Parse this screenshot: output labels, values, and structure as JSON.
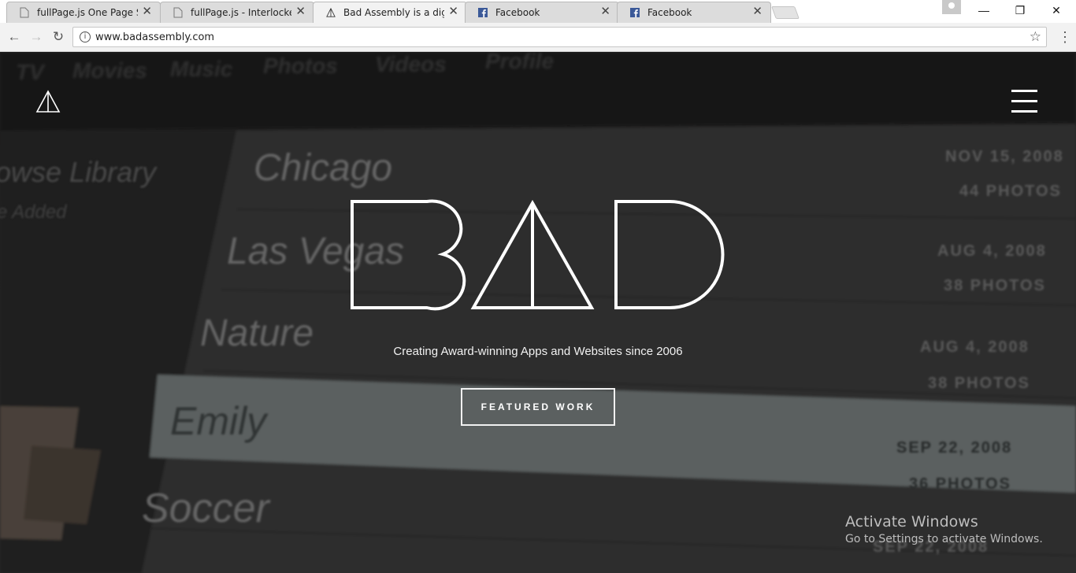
{
  "browser": {
    "tabs": [
      {
        "title": "fullPage.js One Page Scroll",
        "icon": "page-icon",
        "active": false
      },
      {
        "title": "fullPage.js - Interlocked S",
        "icon": "page-icon",
        "active": false
      },
      {
        "title": "Bad Assembly is a digital",
        "icon": "bad-triangle-icon",
        "active": true
      },
      {
        "title": "Facebook",
        "icon": "facebook-icon",
        "active": false
      },
      {
        "title": "Facebook",
        "icon": "facebook-icon",
        "active": false
      }
    ],
    "url": "www.badassembly.com"
  },
  "background": {
    "nav_words": [
      "TV",
      "Movies",
      "Music",
      "Photos",
      "Videos",
      "Profile"
    ],
    "side_words": [
      "owse Library",
      "e Added"
    ],
    "albums": [
      {
        "name": "Chicago",
        "date": "NOV 15, 2008",
        "photos": "44 PHOTOS"
      },
      {
        "name": "Las Vegas",
        "date": "AUG 4, 2008",
        "photos": "38 PHOTOS"
      },
      {
        "name": "Nature",
        "date": "AUG 4, 2008",
        "photos": "38 PHOTOS"
      },
      {
        "name": "Emily",
        "date": "SEP 22, 2008",
        "photos": "36 PHOTOS"
      },
      {
        "name": "Soccer",
        "date": "SEP 22, 2008",
        "photos": ""
      }
    ]
  },
  "hero": {
    "tagline": "Creating Award-winning Apps and Websites since 2006",
    "cta_label": "FEATURED WORK"
  },
  "os_watermark": {
    "line1": "Activate Windows",
    "line2": "Go to Settings to activate Windows."
  }
}
